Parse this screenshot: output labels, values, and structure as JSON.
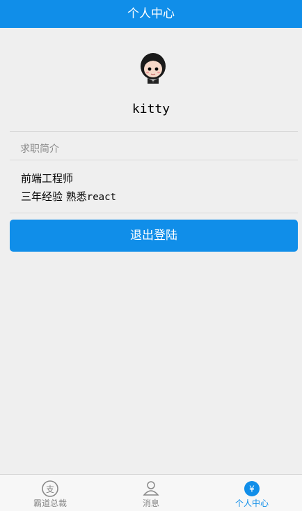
{
  "header": {
    "title": "个人中心"
  },
  "profile": {
    "username": "kitty",
    "avatar_icon": "girl-avatar-icon"
  },
  "intro": {
    "section_title": "求职简介",
    "line1": "前端工程师",
    "line2_prefix": "三年经验 熟悉",
    "line2_suffix": "react"
  },
  "actions": {
    "logout_label": "退出登陆"
  },
  "tabbar": {
    "tabs": [
      {
        "label": "霸道总裁",
        "icon": "boss-icon",
        "active": false
      },
      {
        "label": "消息",
        "icon": "users-icon",
        "active": false
      },
      {
        "label": "个人中心",
        "icon": "yuan-icon",
        "active": true
      }
    ]
  },
  "colors": {
    "brand": "#108ee9",
    "background": "#efefef"
  }
}
